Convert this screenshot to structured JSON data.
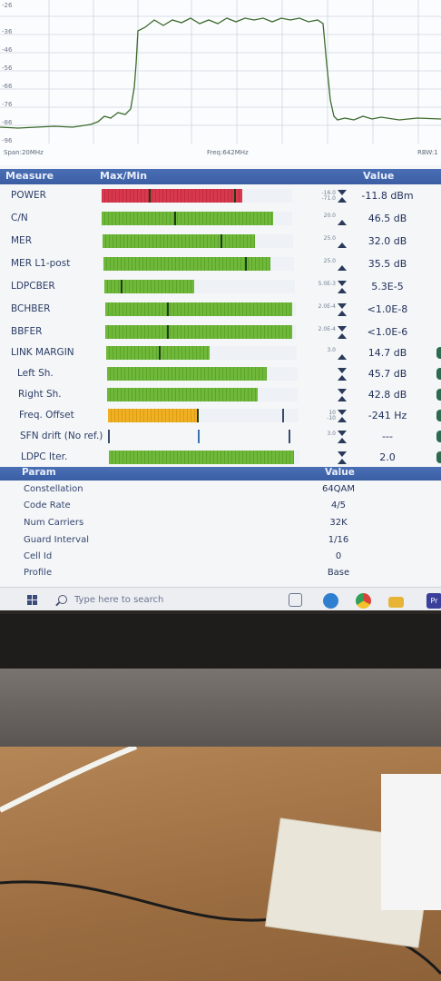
{
  "spectrum": {
    "y_ticks": [
      "-26",
      "-36",
      "-46",
      "-56",
      "-66",
      "-76",
      "-86",
      "-96"
    ],
    "span_label": "Span:20MHz",
    "freq_label": "Freq:642MHz",
    "rbw_label": "RBW:1"
  },
  "table": {
    "col_measure": "Measure",
    "col_maxmin": "Max/Min",
    "col_value": "Value",
    "rows": [
      {
        "label": "POWER",
        "limit_top": "-16.0",
        "limit_bot": "-71.0",
        "value": "-11.8 dBm",
        "color": "#d8384d"
      },
      {
        "label": "C/N",
        "limit_top": "",
        "limit_bot": "20.0",
        "value": "46.5 dB",
        "color": "#6fb83a"
      },
      {
        "label": "MER",
        "limit_top": "",
        "limit_bot": "25.0",
        "value": "32.0 dB",
        "color": "#6fb83a"
      },
      {
        "label": "MER L1-post",
        "limit_top": "",
        "limit_bot": "25.0",
        "value": "35.5 dB",
        "color": "#6fb83a"
      },
      {
        "label": "LDPCBER",
        "limit_top": "",
        "limit_bot": "5.0E-3",
        "value": "5.3E-5",
        "color": "#6fb83a"
      },
      {
        "label": "BCHBER",
        "limit_top": "",
        "limit_bot": "2.0E-4",
        "value": "<1.0E-8",
        "color": "#6fb83a"
      },
      {
        "label": "BBFER",
        "limit_top": "",
        "limit_bot": "2.0E-4",
        "value": "<1.0E-6",
        "color": "#6fb83a"
      },
      {
        "label": "LINK MARGIN",
        "limit_top": "",
        "limit_bot": "3.0",
        "value": "14.7 dB",
        "color": "#6fb83a"
      },
      {
        "label": "Left Sh.",
        "limit_top": "",
        "limit_bot": "",
        "value": "45.7 dB",
        "color": "#6fb83a"
      },
      {
        "label": "Right Sh.",
        "limit_top": "",
        "limit_bot": "",
        "value": "42.8 dB",
        "color": "#6fb83a"
      },
      {
        "label": "Freq. Offset",
        "limit_top": "10",
        "limit_bot": "-10",
        "value": "-241 Hz",
        "color": "#f0b024"
      },
      {
        "label": "SFN drift (No ref.)",
        "limit_top": "",
        "limit_bot": "3.0",
        "value": "---",
        "color": ""
      },
      {
        "label": "LDPC Iter.",
        "limit_top": "",
        "limit_bot": "",
        "value": "2.0",
        "color": "#6fb83a"
      }
    ]
  },
  "params": {
    "col_param": "Param",
    "col_value": "Value",
    "rows": [
      {
        "label": "Constellation",
        "value": "64QAM"
      },
      {
        "label": "Code Rate",
        "value": "4/5"
      },
      {
        "label": "Num Carriers",
        "value": "32K"
      },
      {
        "label": "Guard Interval",
        "value": "1/16"
      },
      {
        "label": "Cell Id",
        "value": "0"
      },
      {
        "label": "Profile",
        "value": "Base"
      }
    ]
  },
  "taskbar": {
    "search_placeholder": "Type here to search",
    "app_icons": [
      "windows-icon",
      "search-icon",
      "task-view-icon",
      "edge-icon",
      "chrome-icon",
      "file-explorer-icon",
      "app-icon"
    ],
    "last_icon_text": "Pr"
  }
}
